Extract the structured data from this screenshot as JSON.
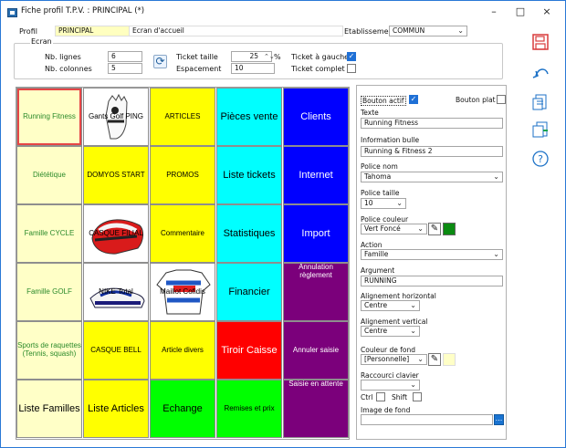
{
  "window": {
    "title": "Fiche profil T.P.V. : PRINCIPAL (*)",
    "minimize": "–",
    "maximize": "□",
    "close": "×"
  },
  "header": {
    "profil_label": "Profil",
    "profil_value": "PRINCIPAL",
    "profile_name": "Ecran d'accueil",
    "etablissement_label": "Etablissement",
    "etablissement_value": "COMMUN",
    "etablissement_caret": "⌄"
  },
  "ecran": {
    "label": "Ecran",
    "nb_lignes_label": "Nb. lignes",
    "nb_lignes": "6",
    "nb_colonnes_label": "Nb. colonnes",
    "nb_colonnes": "5",
    "ticket_taille_label": "Ticket taille",
    "ticket_taille": "25",
    "ticket_taille_unit": "%",
    "espacement_label": "Espacement",
    "espacement": "10",
    "ticket_gauche_label": "Ticket à gauche",
    "ticket_complet_label": "Ticket complet",
    "ticket_gauche_checked": true,
    "ticket_complet_checked": false
  },
  "tiles": [
    {
      "label": "Running Fitness",
      "bg": "#ffffc7",
      "fg": "#2b8a2b"
    },
    {
      "label": "Gants Golf PING",
      "bg": "#ffffff",
      "fg": "#000000",
      "image": "glove"
    },
    {
      "label": "ARTICLES",
      "bg": "#ffff00",
      "fg": "#000000"
    },
    {
      "label": "Pièces vente",
      "bg": "#00ffff",
      "fg": "#000000"
    },
    {
      "label": "Clients",
      "bg": "#0000ff",
      "fg": "#ffffff"
    },
    {
      "label": "Diététique",
      "bg": "#ffffc7",
      "fg": "#2b8a2b"
    },
    {
      "label": "DOMYOS START",
      "bg": "#ffff00",
      "fg": "#000000"
    },
    {
      "label": "PROMOS",
      "bg": "#ffff00",
      "fg": "#000000"
    },
    {
      "label": "Liste tickets",
      "bg": "#00ffff",
      "fg": "#000000"
    },
    {
      "label": "Internet",
      "bg": "#0000ff",
      "fg": "#ffffff"
    },
    {
      "label": "Famille CYCLE",
      "bg": "#ffffc7",
      "fg": "#2b8a2b"
    },
    {
      "label": "CASQUE FILIAL",
      "bg": "#ffffff",
      "fg": "#000000",
      "image": "helmet"
    },
    {
      "label": "Commentaire",
      "bg": "#ffff00",
      "fg": "#000000"
    },
    {
      "label": "Statistiques",
      "bg": "#00ffff",
      "fg": "#000000"
    },
    {
      "label": "Import",
      "bg": "#0000ff",
      "fg": "#ffffff"
    },
    {
      "label": "Famille GOLF",
      "bg": "#ffffc7",
      "fg": "#2b8a2b"
    },
    {
      "label": "NIKE Total",
      "bg": "#ffffff",
      "fg": "#000000",
      "image": "shoe"
    },
    {
      "label": "Maillot Cofidis",
      "bg": "#ffffff",
      "fg": "#000000",
      "image": "jersey"
    },
    {
      "label": "Financier",
      "bg": "#00ffff",
      "fg": "#000000"
    },
    {
      "label": "Annulation règlement",
      "bg": "#7b007b",
      "fg": "#ffffff"
    },
    {
      "label": "Sports de raquettes (Tennis, squash)",
      "bg": "#ffffc7",
      "fg": "#2b8a2b"
    },
    {
      "label": "CASQUE BELL",
      "bg": "#ffff00",
      "fg": "#000000"
    },
    {
      "label": "Article divers",
      "bg": "#ffff00",
      "fg": "#000000"
    },
    {
      "label": "Tiroir Caisse",
      "bg": "#ff0000",
      "fg": "#ffffff"
    },
    {
      "label": "Annuler saisie",
      "bg": "#7b007b",
      "fg": "#ffffff"
    },
    {
      "label": "Liste Familles",
      "bg": "#ffffc7",
      "fg": "#000000"
    },
    {
      "label": "Liste Articles",
      "bg": "#ffff00",
      "fg": "#000000"
    },
    {
      "label": "Echange",
      "bg": "#00ff00",
      "fg": "#000000"
    },
    {
      "label": "Remises et prix",
      "bg": "#00ff00",
      "fg": "#000000"
    },
    {
      "label": "Saisie en attente",
      "bg": "#7b007b",
      "fg": "#ffffff"
    }
  ],
  "properties": {
    "bouton_actif_label": "Bouton actif",
    "bouton_plat_label": "Bouton plat",
    "texte_label": "Texte",
    "texte": "Running Fitness",
    "info_label": "Information bulle",
    "info": "Running & Fitness 2",
    "police_nom_label": "Police nom",
    "police_nom": "Tahoma",
    "police_taille_label": "Police taille",
    "police_taille": "10",
    "police_couleur_label": "Police couleur",
    "police_couleur": "Vert Foncé",
    "action_label": "Action",
    "action": "Famille",
    "argument_label": "Argument",
    "argument": "RUNNING",
    "align_h_label": "Alignement horizontal",
    "align_h": "Centre",
    "align_v_label": "Alignement vertical",
    "align_v": "Centre",
    "couleur_fond_label": "Couleur de fond",
    "couleur_fond": "[Personnelle]",
    "raccourci_label": "Raccourci clavier",
    "raccourci": "",
    "ctrl_label": "Ctrl",
    "shift_label": "Shift",
    "image_fond_label": "Image de fond",
    "image_fond": "",
    "dots": "..."
  },
  "colors": {
    "accent": "#1f70d6",
    "font_color": "#008000",
    "background_color": "#ffffc7"
  },
  "icons": {
    "save": "💾",
    "undo": "↶",
    "document": "▤",
    "copy": "❐",
    "help": "?"
  }
}
